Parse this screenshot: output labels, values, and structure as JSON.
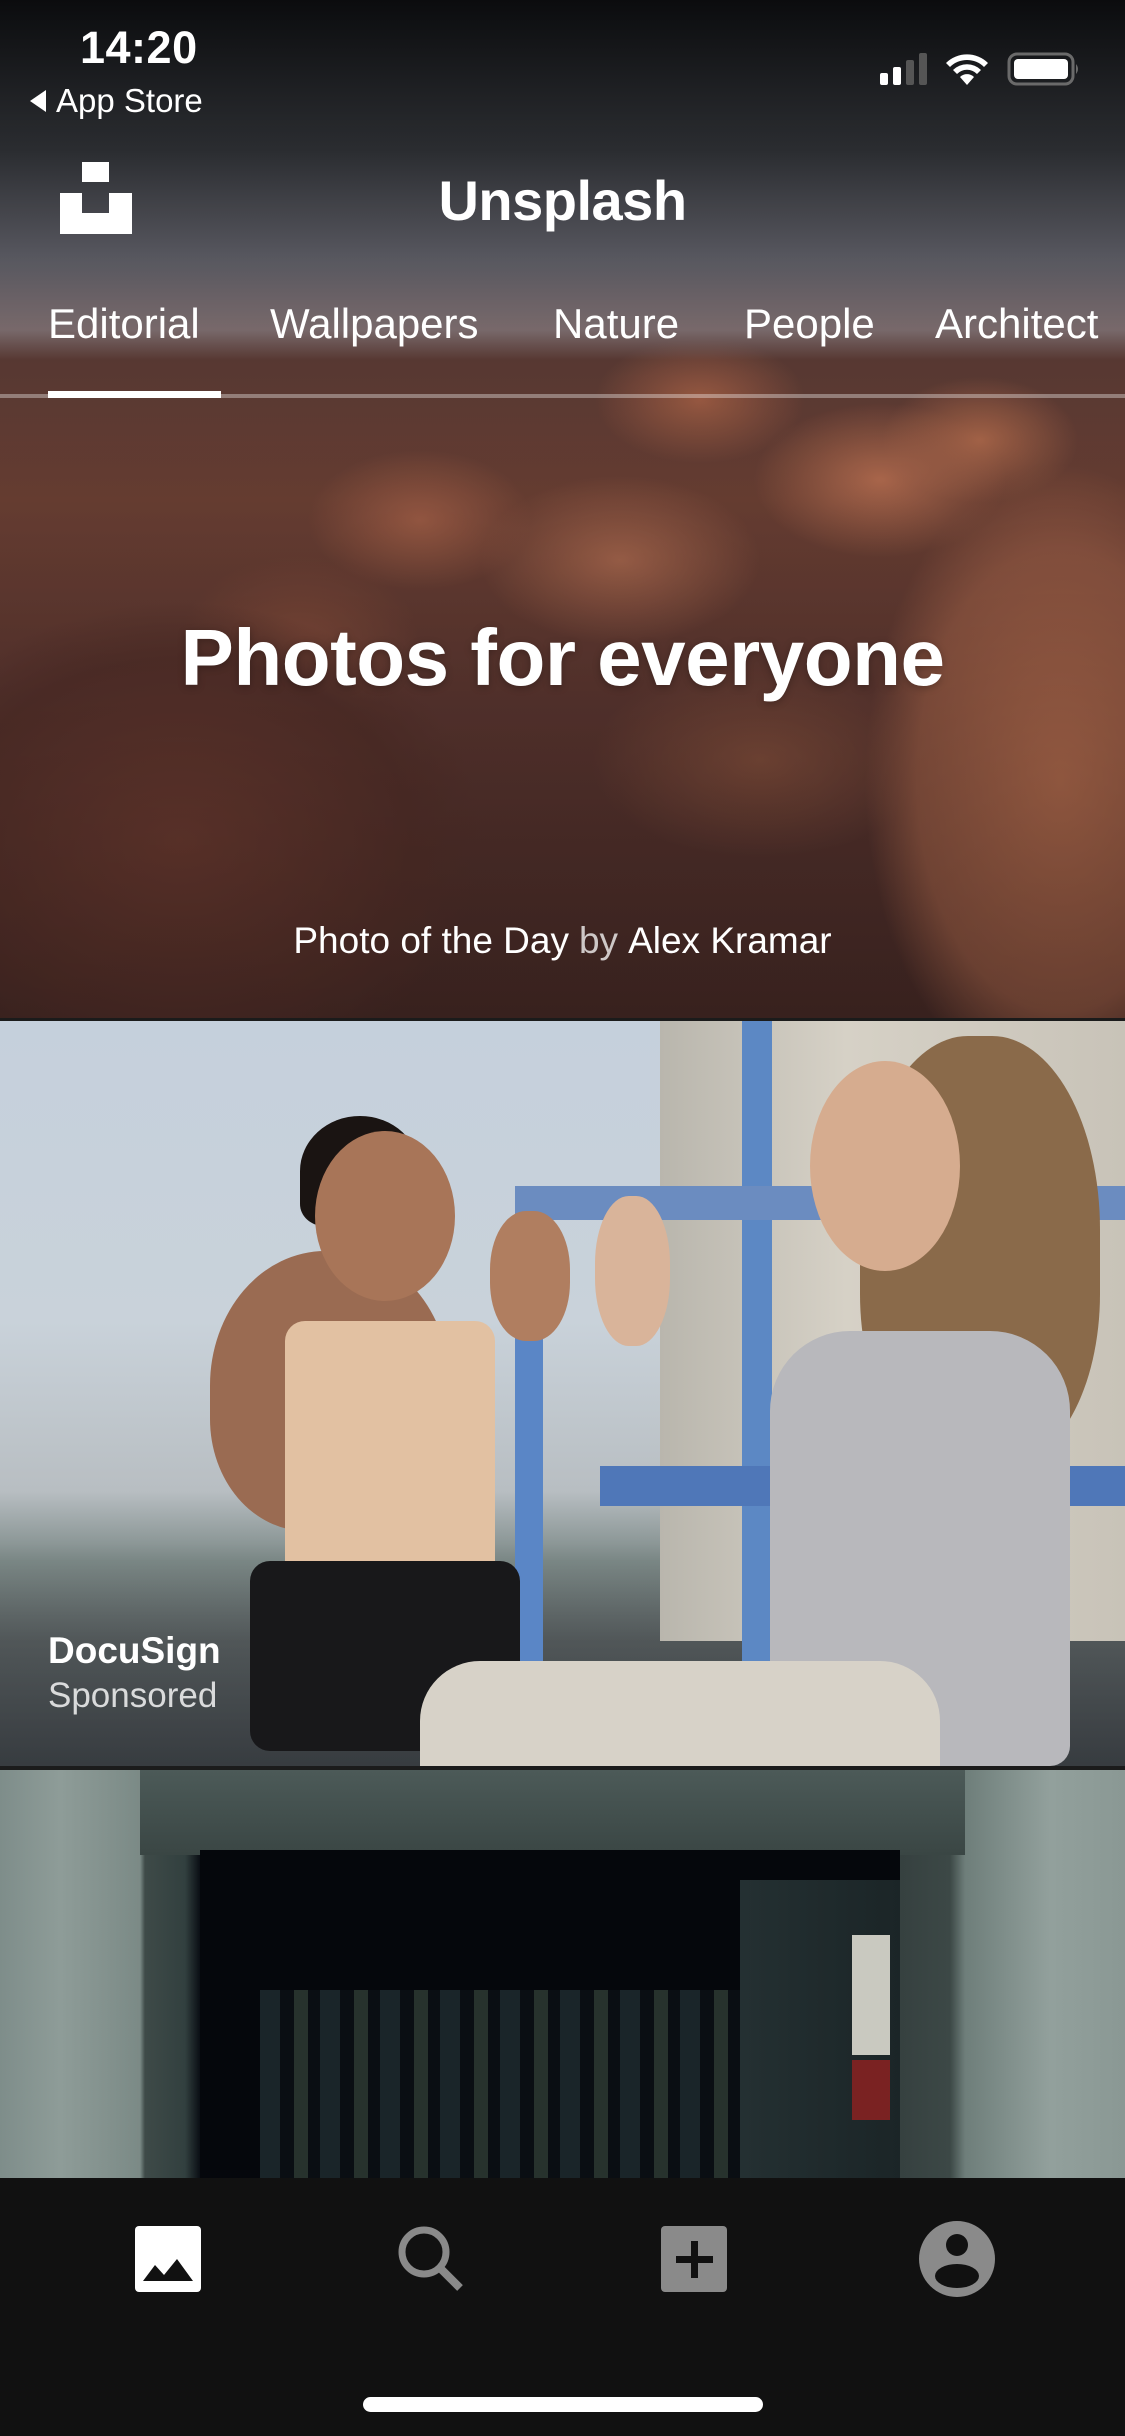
{
  "status_bar": {
    "time": "14:20",
    "back_label": "App Store",
    "icons": [
      "signal-icon",
      "wifi-icon",
      "battery-icon"
    ],
    "signal_bars_active": 2,
    "signal_bars_total": 4
  },
  "header": {
    "logo": "unsplash-logo-icon",
    "title": "Unsplash"
  },
  "categories": {
    "items": [
      {
        "label": "Editorial",
        "active": true
      },
      {
        "label": "Wallpapers",
        "active": false
      },
      {
        "label": "Nature",
        "active": false
      },
      {
        "label": "People",
        "active": false
      },
      {
        "label": "Architect",
        "active": false
      }
    ]
  },
  "hero": {
    "title": "Photos for everyone",
    "caption_prefix": "Photo of the Day",
    "caption_by": "by",
    "photographer": "Alex Kramar"
  },
  "feed": {
    "items": [
      {
        "brand": "DocuSign",
        "tag": "Sponsored"
      },
      {
        "brand": "",
        "tag": ""
      }
    ]
  },
  "tabbar": {
    "items": [
      {
        "name": "photos",
        "icon": "image-icon",
        "active": true
      },
      {
        "name": "search",
        "icon": "search-icon",
        "active": false
      },
      {
        "name": "upload",
        "icon": "add-square-icon",
        "active": false
      },
      {
        "name": "profile",
        "icon": "account-circle-icon",
        "active": false
      }
    ]
  },
  "colors": {
    "text": "#ffffff",
    "tabbar_bg": "#111111",
    "tab_active": "#ffffff",
    "tab_inactive": "#8a8a8a"
  }
}
